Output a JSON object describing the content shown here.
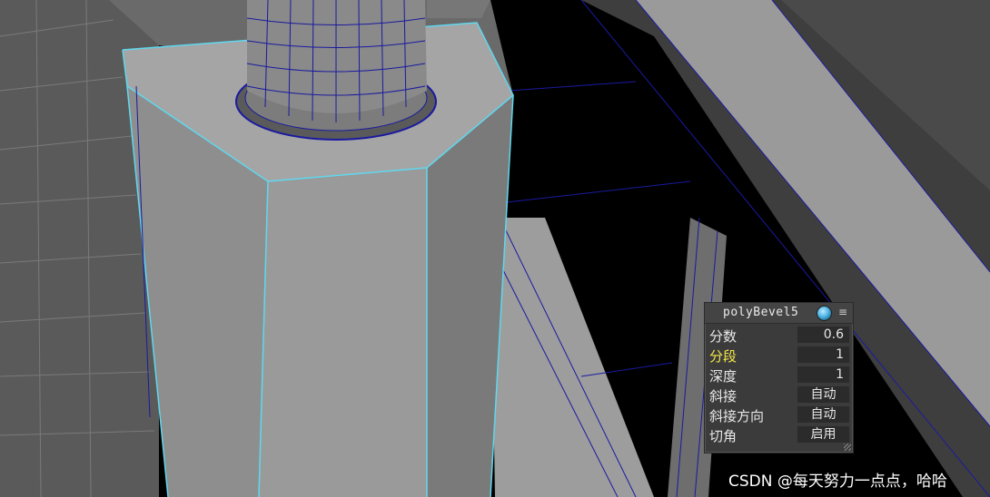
{
  "hud": {
    "title": "polyBevel5",
    "rows": [
      {
        "label": "分数",
        "value": "0.6"
      },
      {
        "label": "分段",
        "value": "1"
      },
      {
        "label": "深度",
        "value": "1"
      },
      {
        "label": "斜接",
        "value": "自动"
      },
      {
        "label": "斜接方向",
        "value": "自动"
      },
      {
        "label": "切角",
        "value": "启用"
      }
    ]
  },
  "watermark": "CSDN @每天努力一点点，哈哈",
  "icons": {
    "node": "node-sphere-icon",
    "menu": "menu-lines-icon"
  },
  "colors": {
    "selection_edge": "#5fd8ee",
    "wire_edge": "#1a1aa0",
    "highlight_label": "#f4e64a",
    "mesh_face": "#9a9a9a"
  }
}
